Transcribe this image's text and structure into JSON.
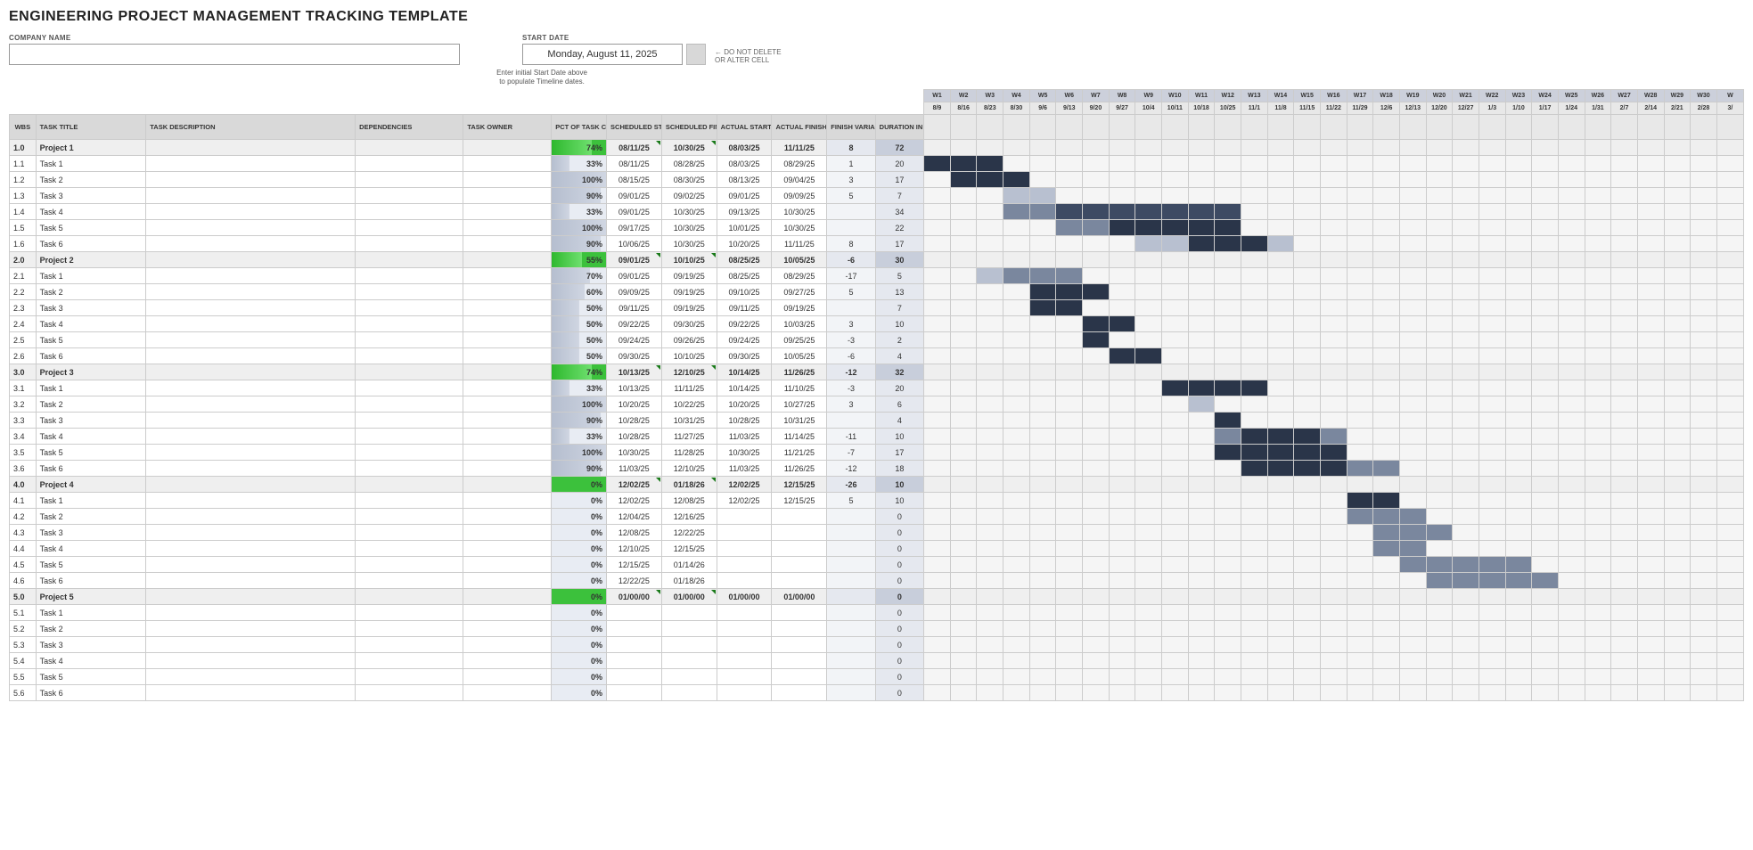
{
  "title": "ENGINEERING PROJECT MANAGEMENT TRACKING TEMPLATE",
  "labels": {
    "company": "COMPANY NAME",
    "start_date": "START DATE",
    "start_date_val": "Monday, August 11, 2025",
    "note": "← DO NOT DELETE\nOR ALTER CELL",
    "hint": "Enter initial Start Date above\nto populate Timeline dates."
  },
  "cols": {
    "wbs": "WBS",
    "title": "TASK TITLE",
    "desc": "TASK DESCRIPTION",
    "dep": "DEPENDENCIES",
    "owner": "TASK OWNER",
    "pct": "PCT OF TASK COMPLETE",
    "ss": "SCHEDULED START",
    "sf": "SCHEDULED FINISH",
    "as": "ACTUAL START",
    "af": "ACTUAL FINISH",
    "var": "FINISH VARIANCE",
    "dur": "DURATION IN DAYS"
  },
  "weeks": [
    "W1",
    "W2",
    "W3",
    "W4",
    "W5",
    "W6",
    "W7",
    "W8",
    "W9",
    "W10",
    "W11",
    "W12",
    "W13",
    "W14",
    "W15",
    "W16",
    "W17",
    "W18",
    "W19",
    "W20",
    "W21",
    "W22",
    "W23",
    "W24",
    "W25",
    "W26",
    "W27",
    "W28",
    "W29",
    "W30",
    "W"
  ],
  "weekDates": [
    "8/9",
    "8/16",
    "8/23",
    "8/30",
    "9/6",
    "9/13",
    "9/20",
    "9/27",
    "10/4",
    "10/11",
    "10/18",
    "10/25",
    "11/1",
    "11/8",
    "11/15",
    "11/22",
    "11/29",
    "12/6",
    "12/13",
    "12/20",
    "12/27",
    "1/3",
    "1/10",
    "1/17",
    "1/24",
    "1/31",
    "2/7",
    "2/14",
    "2/21",
    "2/28",
    "3/"
  ],
  "chart_data": {
    "type": "gantt",
    "time_axis_weeks": [
      "W1",
      "W2",
      "W3",
      "W4",
      "W5",
      "W6",
      "W7",
      "W8",
      "W9",
      "W10",
      "W11",
      "W12",
      "W13",
      "W14",
      "W15",
      "W16",
      "W17",
      "W18",
      "W19",
      "W20",
      "W21",
      "W22",
      "W23",
      "W24",
      "W25",
      "W26",
      "W27",
      "W28",
      "W29",
      "W30"
    ],
    "time_axis_dates": [
      "8/9",
      "8/16",
      "8/23",
      "8/30",
      "9/6",
      "9/13",
      "9/20",
      "9/27",
      "10/4",
      "10/11",
      "10/18",
      "10/25",
      "11/1",
      "11/8",
      "11/15",
      "11/22",
      "11/29",
      "12/6",
      "12/13",
      "12/20",
      "12/27",
      "1/3",
      "1/10",
      "1/17",
      "1/24",
      "1/31",
      "2/7",
      "2/14",
      "2/21",
      "2/28"
    ],
    "rows": [
      {
        "wbs": "1.0",
        "title": "Project 1",
        "project": true,
        "pct": 74,
        "ss": "08/11/25",
        "sf": "10/30/25",
        "as": "08/03/25",
        "af": "11/11/25",
        "var": 8,
        "dur": 72,
        "bar": [
          1,
          12,
          "green"
        ],
        "extra": [
          [
            12,
            13,
            "yellow"
          ]
        ]
      },
      {
        "wbs": "1.1",
        "title": "Task 1",
        "pct": 33,
        "ss": "08/11/25",
        "sf": "08/28/25",
        "as": "08/03/25",
        "af": "08/29/25",
        "var": 1,
        "dur": 20,
        "bar": [
          1,
          3,
          "dark"
        ]
      },
      {
        "wbs": "1.2",
        "title": "Task 2",
        "pct": 100,
        "ss": "08/15/25",
        "sf": "08/30/25",
        "as": "08/13/25",
        "af": "09/04/25",
        "var": 3,
        "dur": 17,
        "bar": [
          2,
          4,
          "dark"
        ]
      },
      {
        "wbs": "1.3",
        "title": "Task 3",
        "pct": 90,
        "ss": "09/01/25",
        "sf": "09/02/25",
        "as": "09/01/25",
        "af": "09/09/25",
        "var": 5,
        "dur": 7,
        "bar": [
          4,
          5,
          "light"
        ]
      },
      {
        "wbs": "1.4",
        "title": "Task 4",
        "pct": 33,
        "ss": "09/01/25",
        "sf": "10/30/25",
        "as": "09/13/25",
        "af": "10/30/25",
        "var": "",
        "dur": 34,
        "bar": [
          4,
          12,
          "med"
        ],
        "extra": [
          [
            6,
            12,
            "darkish"
          ]
        ]
      },
      {
        "wbs": "1.5",
        "title": "Task 5",
        "pct": 100,
        "ss": "09/17/25",
        "sf": "10/30/25",
        "as": "10/01/25",
        "af": "10/30/25",
        "var": "",
        "dur": 22,
        "bar": [
          6,
          12,
          "med"
        ],
        "extra": [
          [
            8,
            12,
            "dark"
          ]
        ]
      },
      {
        "wbs": "1.6",
        "title": "Task 6",
        "pct": 90,
        "ss": "10/06/25",
        "sf": "10/30/25",
        "as": "10/20/25",
        "af": "11/11/25",
        "var": 8,
        "dur": 17,
        "bar": [
          9,
          14,
          "light"
        ],
        "extra": [
          [
            11,
            13,
            "dark"
          ]
        ]
      },
      {
        "wbs": "2.0",
        "title": "Project 2",
        "project": true,
        "pct": 55,
        "ss": "09/01/25",
        "sf": "10/10/25",
        "as": "08/25/25",
        "af": "10/05/25",
        "var": -6,
        "dur": 30,
        "bar": [
          4,
          9,
          "green"
        ],
        "extra": [
          [
            3,
            4,
            "yellow"
          ],
          [
            9,
            9,
            "lgreen"
          ]
        ]
      },
      {
        "wbs": "2.1",
        "title": "Task 1",
        "pct": 70,
        "ss": "09/01/25",
        "sf": "09/19/25",
        "as": "08/25/25",
        "af": "08/29/25",
        "var": -17,
        "dur": 5,
        "bar": [
          3,
          6,
          "light"
        ],
        "extra": [
          [
            4,
            6,
            "med"
          ]
        ]
      },
      {
        "wbs": "2.2",
        "title": "Task 2",
        "pct": 60,
        "ss": "09/09/25",
        "sf": "09/19/25",
        "as": "09/10/25",
        "af": "09/27/25",
        "var": 5,
        "dur": 13,
        "bar": [
          5,
          7,
          "dark"
        ]
      },
      {
        "wbs": "2.3",
        "title": "Task 3",
        "pct": 50,
        "ss": "09/11/25",
        "sf": "09/19/25",
        "as": "09/11/25",
        "af": "09/19/25",
        "var": "",
        "dur": 7,
        "bar": [
          5,
          6,
          "dark"
        ]
      },
      {
        "wbs": "2.4",
        "title": "Task 4",
        "pct": 50,
        "ss": "09/22/25",
        "sf": "09/30/25",
        "as": "09/22/25",
        "af": "10/03/25",
        "var": 3,
        "dur": 10,
        "bar": [
          7,
          8,
          "dark"
        ]
      },
      {
        "wbs": "2.5",
        "title": "Task 5",
        "pct": 50,
        "ss": "09/24/25",
        "sf": "09/26/25",
        "as": "09/24/25",
        "af": "09/25/25",
        "var": -3,
        "dur": 2,
        "bar": [
          7,
          7,
          "dark"
        ]
      },
      {
        "wbs": "2.6",
        "title": "Task 6",
        "pct": 50,
        "ss": "09/30/25",
        "sf": "10/10/25",
        "as": "09/30/25",
        "af": "10/05/25",
        "var": -6,
        "dur": 4,
        "bar": [
          8,
          9,
          "dark"
        ]
      },
      {
        "wbs": "3.0",
        "title": "Project 3",
        "project": true,
        "pct": 74,
        "ss": "10/13/25",
        "sf": "12/10/25",
        "as": "10/14/25",
        "af": "11/26/25",
        "var": -12,
        "dur": 32,
        "bar": [
          10,
          17,
          "green"
        ],
        "extra": [
          [
            16,
            17,
            "lgreen"
          ]
        ]
      },
      {
        "wbs": "3.1",
        "title": "Task 1",
        "pct": 33,
        "ss": "10/13/25",
        "sf": "11/11/25",
        "as": "10/14/25",
        "af": "11/10/25",
        "var": -3,
        "dur": 20,
        "bar": [
          10,
          13,
          "dark"
        ]
      },
      {
        "wbs": "3.2",
        "title": "Task 2",
        "pct": 100,
        "ss": "10/20/25",
        "sf": "10/22/25",
        "as": "10/20/25",
        "af": "10/27/25",
        "var": 3,
        "dur": 6,
        "bar": [
          11,
          11,
          "light"
        ]
      },
      {
        "wbs": "3.3",
        "title": "Task 3",
        "pct": 90,
        "ss": "10/28/25",
        "sf": "10/31/25",
        "as": "10/28/25",
        "af": "10/31/25",
        "var": "",
        "dur": 4,
        "bar": [
          12,
          12,
          "dark"
        ]
      },
      {
        "wbs": "3.4",
        "title": "Task 4",
        "pct": 33,
        "ss": "10/28/25",
        "sf": "11/27/25",
        "as": "11/03/25",
        "af": "11/14/25",
        "var": -11,
        "dur": 10,
        "bar": [
          12,
          16,
          "med"
        ],
        "extra": [
          [
            13,
            15,
            "dark"
          ]
        ]
      },
      {
        "wbs": "3.5",
        "title": "Task 5",
        "pct": 100,
        "ss": "10/30/25",
        "sf": "11/28/25",
        "as": "10/30/25",
        "af": "11/21/25",
        "var": -7,
        "dur": 17,
        "bar": [
          12,
          16,
          "dark"
        ]
      },
      {
        "wbs": "3.6",
        "title": "Task 6",
        "pct": 90,
        "ss": "11/03/25",
        "sf": "12/10/25",
        "as": "11/03/25",
        "af": "11/26/25",
        "var": -12,
        "dur": 18,
        "bar": [
          13,
          17,
          "dark"
        ],
        "extra": [
          [
            17,
            18,
            "med"
          ]
        ]
      },
      {
        "wbs": "4.0",
        "title": "Project 4",
        "project": true,
        "pct": 0,
        "ss": "12/02/25",
        "sf": "01/18/26",
        "as": "12/02/25",
        "af": "12/15/25",
        "var": -26,
        "dur": 10,
        "bar": [
          17,
          24,
          "lgreen"
        ],
        "extra": [
          [
            17,
            18,
            "green"
          ]
        ]
      },
      {
        "wbs": "4.1",
        "title": "Task 1",
        "pct": 0,
        "ss": "12/02/25",
        "sf": "12/08/25",
        "as": "12/02/25",
        "af": "12/15/25",
        "var": 5,
        "dur": 10,
        "bar": [
          17,
          18,
          "dark"
        ]
      },
      {
        "wbs": "4.2",
        "title": "Task 2",
        "pct": 0,
        "ss": "12/04/25",
        "sf": "12/16/25",
        "as": "",
        "af": "",
        "var": "",
        "dur": 0,
        "bar": [
          17,
          19,
          "med"
        ]
      },
      {
        "wbs": "4.3",
        "title": "Task 3",
        "pct": 0,
        "ss": "12/08/25",
        "sf": "12/22/25",
        "as": "",
        "af": "",
        "var": "",
        "dur": 0,
        "bar": [
          18,
          20,
          "med"
        ]
      },
      {
        "wbs": "4.4",
        "title": "Task 4",
        "pct": 0,
        "ss": "12/10/25",
        "sf": "12/15/25",
        "as": "",
        "af": "",
        "var": "",
        "dur": 0,
        "bar": [
          18,
          19,
          "med"
        ]
      },
      {
        "wbs": "4.5",
        "title": "Task 5",
        "pct": 0,
        "ss": "12/15/25",
        "sf": "01/14/26",
        "as": "",
        "af": "",
        "var": "",
        "dur": 0,
        "bar": [
          19,
          23,
          "med"
        ]
      },
      {
        "wbs": "4.6",
        "title": "Task 6",
        "pct": 0,
        "ss": "12/22/25",
        "sf": "01/18/26",
        "as": "",
        "af": "",
        "var": "",
        "dur": 0,
        "bar": [
          20,
          24,
          "med"
        ]
      },
      {
        "wbs": "5.0",
        "title": "Project 5",
        "project": true,
        "pct": 0,
        "ss": "01/00/00",
        "sf": "01/00/00",
        "as": "01/00/00",
        "af": "01/00/00",
        "var": "",
        "dur": 0
      },
      {
        "wbs": "5.1",
        "title": "Task 1",
        "pct": 0,
        "ss": "",
        "sf": "",
        "as": "",
        "af": "",
        "var": "",
        "dur": 0
      },
      {
        "wbs": "5.2",
        "title": "Task 2",
        "pct": 0,
        "ss": "",
        "sf": "",
        "as": "",
        "af": "",
        "var": "",
        "dur": 0
      },
      {
        "wbs": "5.3",
        "title": "Task 3",
        "pct": 0,
        "ss": "",
        "sf": "",
        "as": "",
        "af": "",
        "var": "",
        "dur": 0
      },
      {
        "wbs": "5.4",
        "title": "Task 4",
        "pct": 0,
        "ss": "",
        "sf": "",
        "as": "",
        "af": "",
        "var": "",
        "dur": 0
      },
      {
        "wbs": "5.5",
        "title": "Task 5",
        "pct": 0,
        "ss": "",
        "sf": "",
        "as": "",
        "af": "",
        "var": "",
        "dur": 0
      },
      {
        "wbs": "5.6",
        "title": "Task 6",
        "pct": 0,
        "ss": "",
        "sf": "",
        "as": "",
        "af": "",
        "var": "",
        "dur": 0
      }
    ]
  }
}
